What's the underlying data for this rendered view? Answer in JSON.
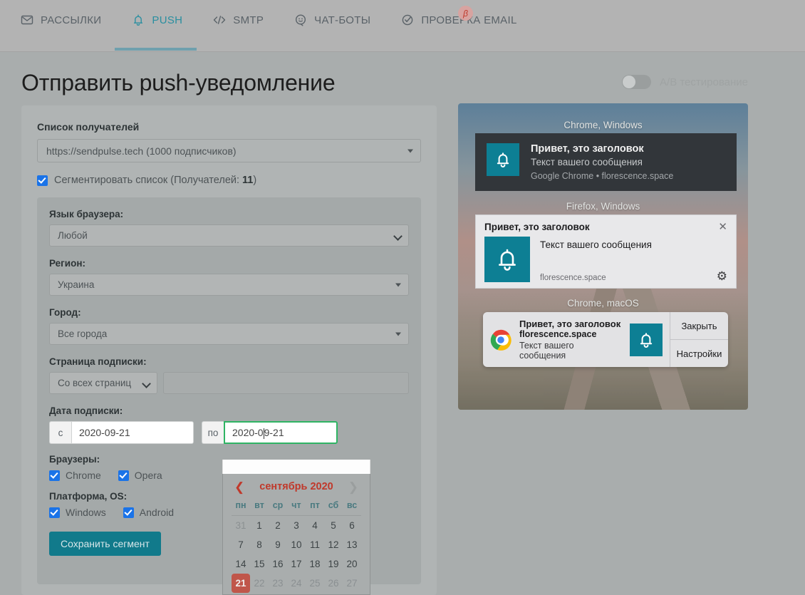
{
  "nav": {
    "items": [
      {
        "label": "РАССЫЛКИ",
        "icon": "envelope-icon",
        "active": false
      },
      {
        "label": "PUSH",
        "icon": "bell-icon",
        "active": true
      },
      {
        "label": "SMTP",
        "icon": "code-icon",
        "active": false
      },
      {
        "label": "ЧАТ-БОТЫ",
        "icon": "chat-bubble-icon",
        "active": false
      },
      {
        "label": "ПРОВЕРКА EMAIL",
        "icon": "check-circle-icon",
        "active": false
      }
    ],
    "beta_badge": "β",
    "active_color": "#2a8fa0"
  },
  "header": {
    "title": "Отправить push-уведомление",
    "ab_testing_label": "A/B тестирование",
    "ab_testing_enabled": false
  },
  "form": {
    "recipients_label": "Список получателей",
    "recipients_value": "https://sendpulse.tech (1000 подписчиков)",
    "segment_checkbox_label": "Сегментировать список (Получателей: ",
    "segment_count": "11",
    "segment_checkbox_suffix": ")",
    "segment_checked": true,
    "fields": {
      "browser_lang_label": "Язык браузера:",
      "browser_lang_value": "Любой",
      "region_label": "Регион:",
      "region_value": "Украина",
      "city_label": "Город:",
      "city_value": "Все города",
      "subscribe_page_label": "Страница подписки:",
      "subscribe_page_value": "Со всех страниц",
      "subscribe_page_url": "",
      "date_label": "Дата подписки:",
      "date_from_prefix": "с",
      "date_from_value": "2020-09-21",
      "date_to_prefix": "по",
      "date_to_value_before_caret": "2020-0",
      "date_to_value_after_caret": "9-21"
    },
    "browsers_label": "Браузеры:",
    "browsers": [
      {
        "label": "Chrome",
        "checked": true
      },
      {
        "label": "Opera",
        "checked": true
      }
    ],
    "platform_label": "Платформа, OS:",
    "platforms": [
      {
        "label": "Windows",
        "checked": true
      },
      {
        "label": "Android",
        "checked": true
      }
    ],
    "save_button": "Сохранить сегмент",
    "save_button_color": "#117a8b",
    "checkbox_color": "#1a73e8"
  },
  "calendar": {
    "month_title": "сентябрь 2020",
    "prev_arrow": "❮",
    "next_arrow": "❯",
    "weekdays": [
      "пн",
      "вт",
      "ср",
      "чт",
      "пт",
      "сб",
      "вс"
    ],
    "weeks": [
      [
        {
          "d": "31",
          "state": "muted"
        },
        {
          "d": "1",
          "state": "normal"
        },
        {
          "d": "2",
          "state": "normal"
        },
        {
          "d": "3",
          "state": "normal"
        },
        {
          "d": "4",
          "state": "normal"
        },
        {
          "d": "5",
          "state": "normal"
        },
        {
          "d": "6",
          "state": "normal"
        }
      ],
      [
        {
          "d": "7",
          "state": "normal"
        },
        {
          "d": "8",
          "state": "normal"
        },
        {
          "d": "9",
          "state": "normal"
        },
        {
          "d": "10",
          "state": "normal"
        },
        {
          "d": "11",
          "state": "normal"
        },
        {
          "d": "12",
          "state": "normal"
        },
        {
          "d": "13",
          "state": "normal"
        }
      ],
      [
        {
          "d": "14",
          "state": "normal"
        },
        {
          "d": "15",
          "state": "normal"
        },
        {
          "d": "16",
          "state": "normal"
        },
        {
          "d": "17",
          "state": "normal"
        },
        {
          "d": "18",
          "state": "normal"
        },
        {
          "d": "19",
          "state": "normal"
        },
        {
          "d": "20",
          "state": "normal"
        }
      ],
      [
        {
          "d": "21",
          "state": "selected"
        },
        {
          "d": "22",
          "state": "muted"
        },
        {
          "d": "23",
          "state": "muted"
        },
        {
          "d": "24",
          "state": "muted"
        },
        {
          "d": "25",
          "state": "muted"
        },
        {
          "d": "26",
          "state": "muted"
        },
        {
          "d": "27",
          "state": "muted"
        }
      ]
    ],
    "selected_color": "#c0564a",
    "title_color": "#c0392b",
    "weekday_color": "#4a7a80"
  },
  "preview": {
    "windows_chrome": {
      "caption": "Chrome, Windows",
      "title": "Привет, это заголовок",
      "body": "Текст вашего сообщения",
      "source": "Google Chrome • florescence.space"
    },
    "windows_firefox": {
      "caption": "Firefox, Windows",
      "title": "Привет, это заголовок",
      "body": "Текст вашего сообщения",
      "domain": "florescence.space",
      "close_icon": "✕",
      "gear_icon": "⚙"
    },
    "macos_chrome": {
      "caption": "Chrome, macOS",
      "title": "Привет, это заголовок",
      "domain": "florescence.space",
      "body": "Текст вашего сообщения",
      "close_button": "Закрыть",
      "settings_button": "Настройки"
    },
    "icon_tile_color": "#0d7f94"
  }
}
